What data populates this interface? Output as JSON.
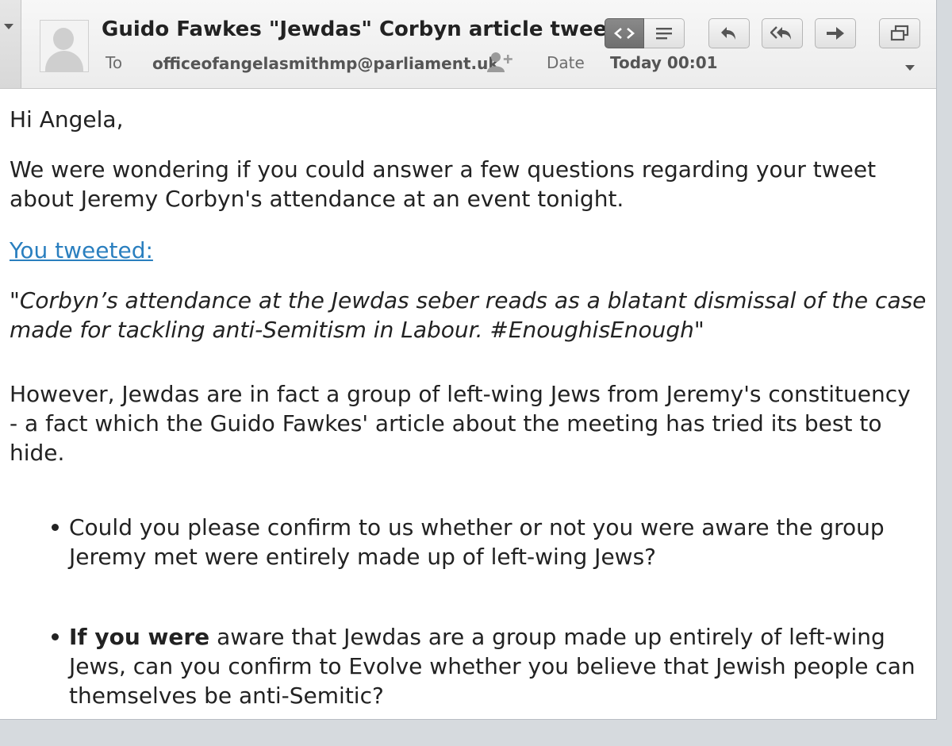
{
  "header": {
    "subject": "Guido Fawkes \"Jewdas\" Corbyn article tweet",
    "to_label": "To",
    "to_value": "officeofangelasmithmp@parliament.uk",
    "date_label": "Date",
    "date_value": "Today 00:01"
  },
  "toolbar": {
    "icons": [
      "code-view-icon",
      "plain-text-icon",
      "reply-icon",
      "reply-all-icon",
      "forward-icon",
      "new-window-icon"
    ]
  },
  "message": {
    "greeting": "Hi Angela,",
    "para1": "We were wondering if you could answer a few questions regarding your tweet about Jeremy Corbyn's attendance at an event tonight.",
    "link": "You tweeted:",
    "quote": "\"Corbyn’s attendance at the Jewdas seber reads as a blatant dismissal of the case made for tackling anti-Semitism in Labour. #EnoughisEnough\"",
    "para2": "However, Jewdas are in fact a group of left-wing Jews from Jeremy's constituency - a fact which the Guido Fawkes' article about the meeting has tried its best to hide.",
    "bullet1": "Could you please confirm to us whether or not you were aware the group Jeremy met were entirely made up of left-wing Jews?",
    "bullet2_bold": "If you were",
    "bullet2_rest": " aware that Jewdas are a group made up entirely of left-wing Jews, can you confirm to Evolve whether you believe that Jewish people can themselves be anti-Semitic?"
  },
  "colors": {
    "link": "#2a7fbf",
    "active_button": "#7a7a7a"
  }
}
